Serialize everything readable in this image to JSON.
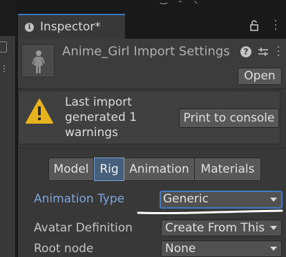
{
  "window_tab": {
    "label": "Inspector*"
  },
  "header": {
    "title": "Anime_Girl Import Settings",
    "open_button": "Open"
  },
  "warning": {
    "message": "Last import\ngenerated 1\nwarnings",
    "print_button": "Print to console"
  },
  "tabs": [
    {
      "label": "Model"
    },
    {
      "label": "Rig"
    },
    {
      "label": "Animation"
    },
    {
      "label": "Materials"
    }
  ],
  "active_tab": "Rig",
  "properties": {
    "animation_type": {
      "label": "Animation Type",
      "value": "Generic"
    },
    "avatar_definition": {
      "label": "Avatar Definition",
      "value": "Create From This"
    },
    "root_node": {
      "label": "Root node",
      "value": "None"
    }
  },
  "colors": {
    "accent": "#3d7ac7",
    "active_tab_bg": "#46607c",
    "highlight_label": "#7ea6d9",
    "warning_icon": "#e6b21e"
  }
}
